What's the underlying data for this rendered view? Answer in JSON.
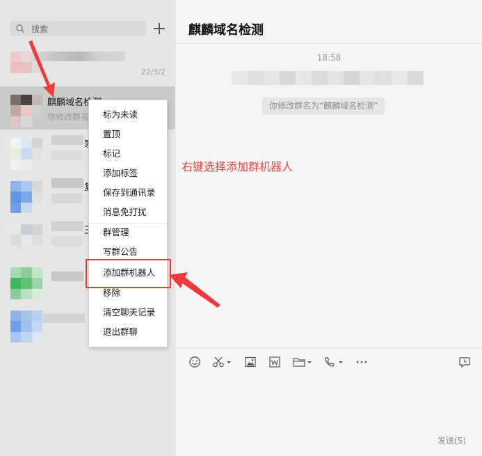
{
  "search": {
    "placeholder": "搜索"
  },
  "chats": [
    {
      "date": "22/3/2"
    },
    {
      "name": "麒麟域名检测",
      "preview": "你修改群名"
    },
    {
      "fragment": "家"
    },
    {
      "fragment": "复"
    },
    {
      "fragment": "王"
    }
  ],
  "conversation": {
    "title": "麒麟域名检测",
    "time": "18:58",
    "system_notice": "你修改群名为“麒麟域名检测”"
  },
  "annotation": "右键选择添加群机器人",
  "context_menu": {
    "items": [
      "标为未读",
      "置顶",
      "标记",
      "添加标签",
      "保存到通讯录",
      "消息免打扰",
      "群管理",
      "写群公告",
      "添加群机器人",
      "移除",
      "清空聊天记录",
      "退出群聊"
    ]
  },
  "toolbar": {
    "icons": [
      "emoji-icon",
      "scissors-icon",
      "image-icon",
      "word-file-icon",
      "folder-icon",
      "phone-icon",
      "more-icon",
      "chat-history-icon"
    ],
    "send_label": "发送(S)"
  },
  "colors": {
    "accent_red": "#e63a3a",
    "annotation": "#e94545"
  }
}
